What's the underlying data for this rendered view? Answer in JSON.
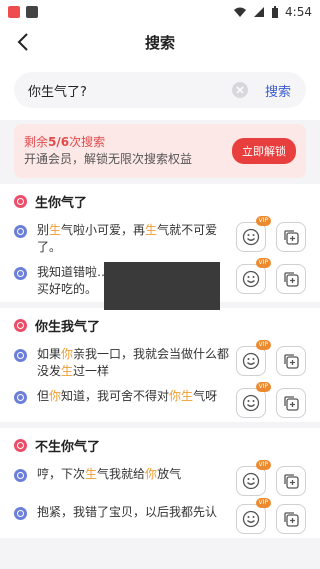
{
  "status": {
    "time": "4:54"
  },
  "header": {
    "title": "搜索"
  },
  "search": {
    "query": "你生气了?",
    "button": "搜索"
  },
  "banner": {
    "remaining_prefix": "剩余",
    "remaining": "5/6",
    "remaining_suffix": "次搜索",
    "desc": "开通会员，解锁无限次搜索权益",
    "unlock": "立即解锁"
  },
  "sections": [
    {
      "title": "生你气了"
    },
    {
      "title": "你生我气了"
    },
    {
      "title": "不生你气了"
    }
  ],
  "vip_badge": "VIP",
  "colors": {
    "accent": "#e83e3e",
    "highlight": "#ef9d32",
    "link": "#3b5bd6"
  }
}
